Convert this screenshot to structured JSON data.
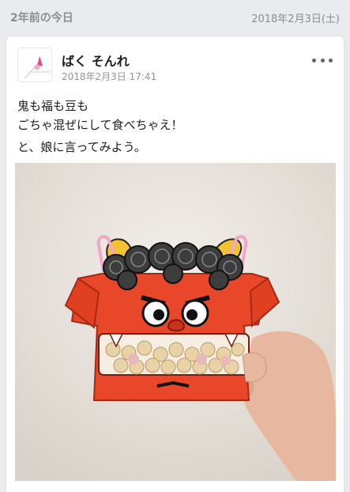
{
  "memory": {
    "title": "2年前の今日",
    "date": "2018年2月3日(土)"
  },
  "post": {
    "author": "ばく そんれ",
    "timestamp": "2018年2月3日 17:41",
    "lines": [
      "鬼も福も豆も",
      "ごちゃ混ぜにして食べちゃえ！",
      "と、娘に言ってみよう。"
    ],
    "photo_icon": "oni-bean-box-photo",
    "more_icon": "more-options-icon"
  },
  "colors": {
    "background": "#e9ebee",
    "card": "#ffffff",
    "oni_red": "#e8472a",
    "meta_text": "#90949c"
  }
}
